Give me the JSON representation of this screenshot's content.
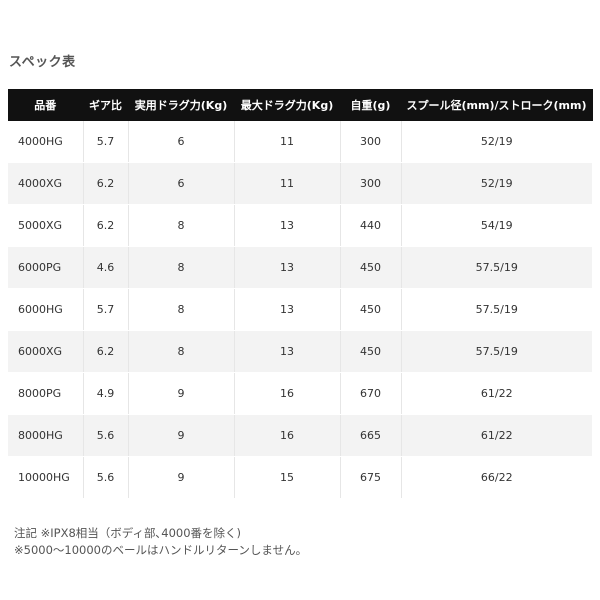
{
  "section_title": "スペック表",
  "table": {
    "headers": [
      "品番",
      "ギア比",
      "実用ドラグ力(Kg)",
      "最大ドラグ力(Kg)",
      "自重(g)",
      "スプール径(mm)/ストローク(mm)"
    ],
    "rows": [
      [
        "4000HG",
        "5.7",
        "6",
        "11",
        "300",
        "52/19"
      ],
      [
        "4000XG",
        "6.2",
        "6",
        "11",
        "300",
        "52/19"
      ],
      [
        "5000XG",
        "6.2",
        "8",
        "13",
        "440",
        "54/19"
      ],
      [
        "6000PG",
        "4.6",
        "8",
        "13",
        "450",
        "57.5/19"
      ],
      [
        "6000HG",
        "5.7",
        "8",
        "13",
        "450",
        "57.5/19"
      ],
      [
        "6000XG",
        "6.2",
        "8",
        "13",
        "450",
        "57.5/19"
      ],
      [
        "8000PG",
        "4.9",
        "9",
        "16",
        "670",
        "61/22"
      ],
      [
        "8000HG",
        "5.6",
        "9",
        "16",
        "665",
        "61/22"
      ],
      [
        "10000HG",
        "5.6",
        "9",
        "15",
        "675",
        "66/22"
      ]
    ]
  },
  "notes": [
    "注記 ※IPX8相当（ボディ部､4000番を除く)",
    "※5000～10000のベールはハンドルリターンしません。"
  ],
  "colors": {
    "header_bg": "#111111",
    "header_text": "#ffffff",
    "row_alt_bg": "#f3f3f3"
  }
}
